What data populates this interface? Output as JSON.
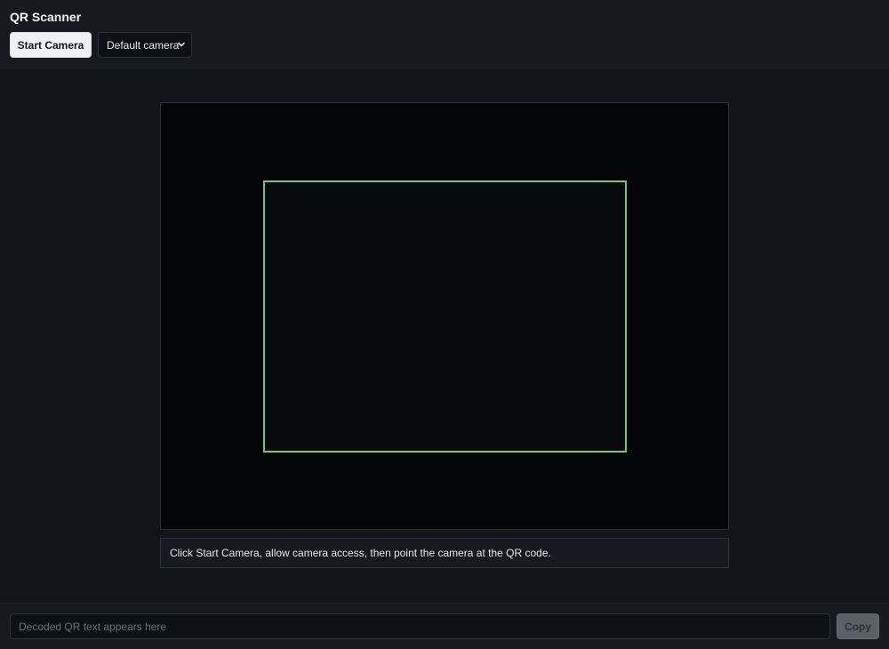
{
  "header": {
    "title": "QR Scanner",
    "start_button_label": "Start Camera",
    "camera_select": {
      "selected": "Default camera"
    }
  },
  "viewer": {
    "frame_color": "#67c98f",
    "status_message": "Click Start Camera, allow camera access, then point the camera at the QR code."
  },
  "footer": {
    "decoded_value": "",
    "decoded_placeholder": "Decoded QR text appears here",
    "copy_button_label": "Copy",
    "copy_enabled": false
  },
  "icons": {
    "select_chevron": "chevron-down-icon"
  }
}
